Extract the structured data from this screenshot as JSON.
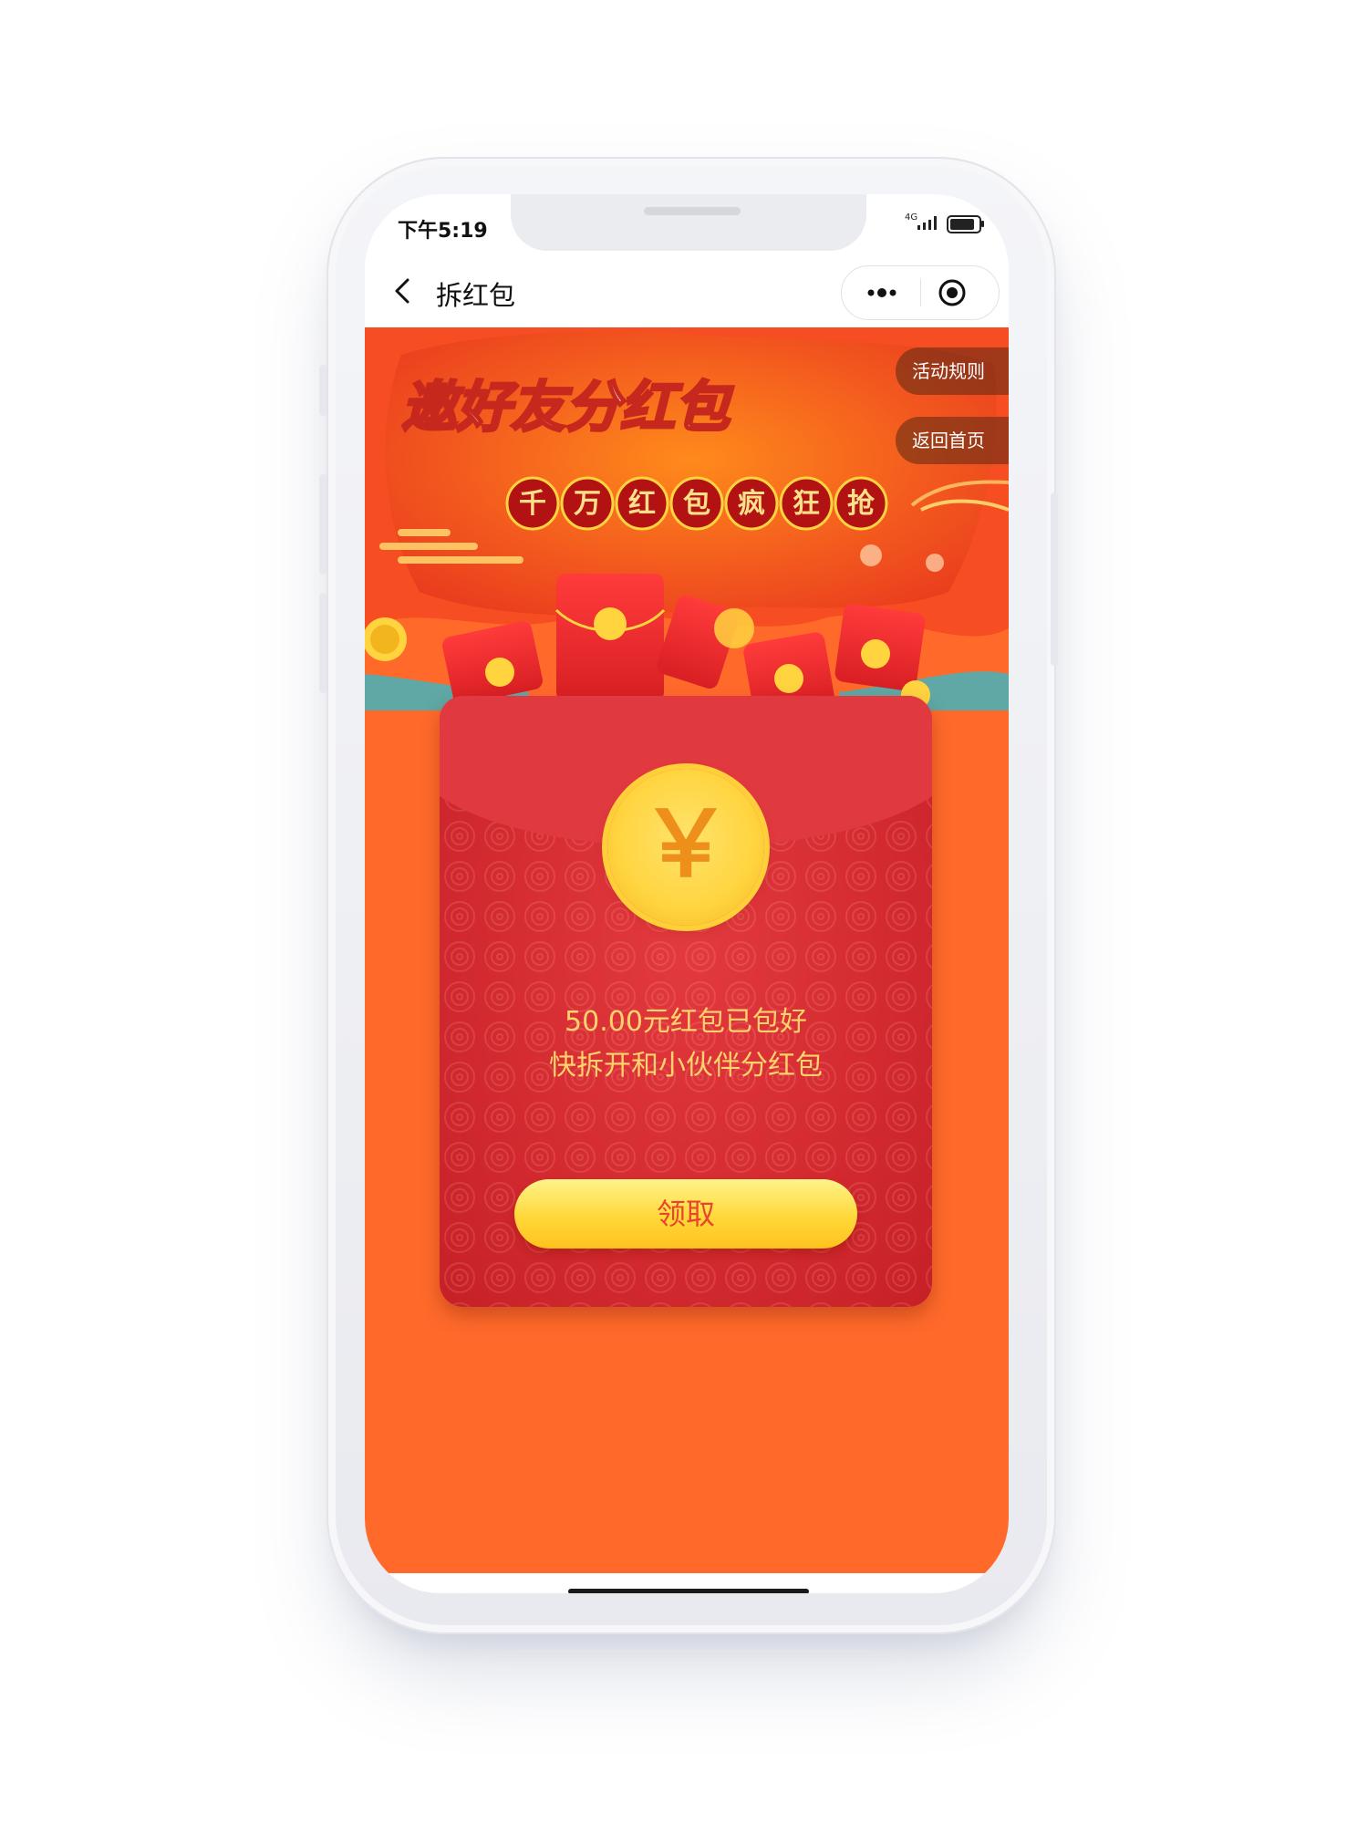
{
  "status_bar": {
    "time": "下午5:19",
    "network": "4G"
  },
  "nav": {
    "title": "拆红包"
  },
  "banner": {
    "headline": "邀好友分红包",
    "subheadline": [
      "千",
      "万",
      "红",
      "包",
      "疯",
      "狂",
      "抢"
    ]
  },
  "side_tags": {
    "rules": "活动规则",
    "home": "返回首页"
  },
  "envelope": {
    "currency_symbol": "￥",
    "line1": "50.00元红包已包好",
    "line2": "快拆开和小伙伴分红包",
    "claim_label": "领取"
  },
  "colors": {
    "page_bg": "#ff6a2b",
    "envelope_red": "#d42b31",
    "flap_red": "#e0393f",
    "gold": "#ffd43f",
    "text_gold": "#ffd36b"
  }
}
